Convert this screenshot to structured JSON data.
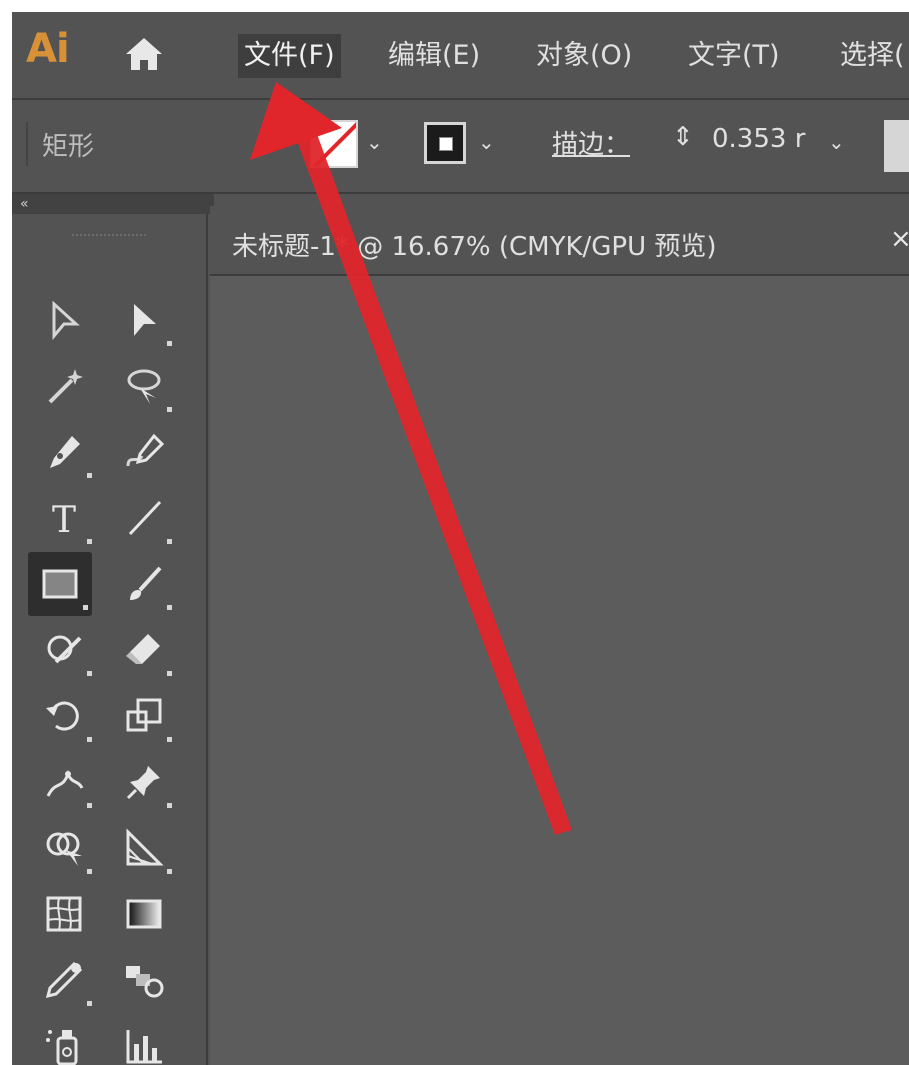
{
  "app": {
    "logo": "Ai"
  },
  "menubar": {
    "items": [
      {
        "label": "文件(F)"
      },
      {
        "label": "编辑(E)"
      },
      {
        "label": "对象(O)"
      },
      {
        "label": "文字(T)"
      },
      {
        "label": "选择("
      }
    ]
  },
  "controlbar": {
    "tool_name": "矩形",
    "stroke_label": "描边：",
    "stroke_value": "0.353 r"
  },
  "document": {
    "tab_title": "未标题-1* @ 16.67% (CMYK/GPU 预览)",
    "close_glyph": "×"
  },
  "toolbar": {
    "collapse_glyph": "«",
    "tools": [
      "selection-tool",
      "direct-selection-tool",
      "magic-wand-tool",
      "lasso-tool",
      "pen-tool",
      "curvature-tool",
      "type-tool",
      "line-segment-tool",
      "rectangle-tool",
      "paintbrush-tool",
      "shaper-tool",
      "eraser-tool",
      "rotate-tool",
      "scale-tool",
      "puppet-warp-tool",
      "pin-tool",
      "shape-builder-tool",
      "perspective-grid-tool",
      "mesh-tool",
      "gradient-tool",
      "eyedropper-tool",
      "blend-tool",
      "symbol-sprayer-tool",
      "column-graph-tool"
    ],
    "selected_tool": "rectangle-tool"
  },
  "colors": {
    "ui_background": "#535353",
    "canvas": "#5c5c5c",
    "logo": "#d99137",
    "annotation_arrow": "#e0262b"
  }
}
